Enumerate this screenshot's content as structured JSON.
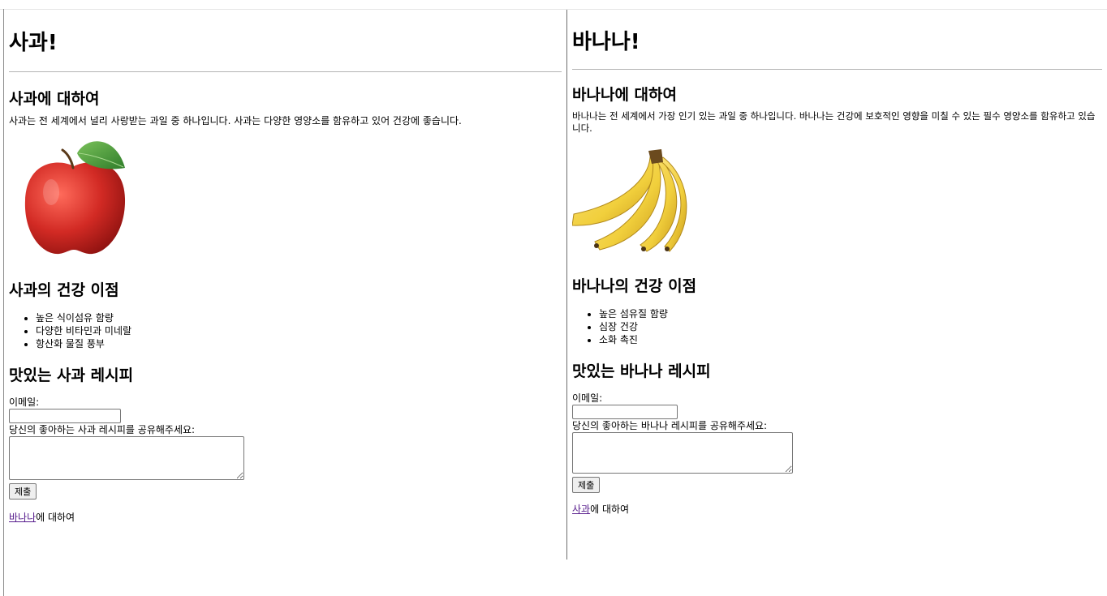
{
  "apple": {
    "title": "사과!",
    "about_heading": "사과에 대하여",
    "description": "사과는 전 세계에서 널리 사랑받는 과일 중 하나입니다. 사과는 다양한 영양소를 함유하고 있어 건강에 좋습니다.",
    "benefits_heading": "사과의 건강 이점",
    "benefits": [
      "높은 식이섬유 함량",
      "다양한 비타민과 미네랄",
      "항산화 물질 풍부"
    ],
    "recipe_heading": "맛있는 사과 레시피",
    "email_label": "이메일:",
    "email_value": "",
    "recipe_label": "당신의 좋아하는 사과 레시피를 공유해주세요:",
    "recipe_value": "",
    "submit_label": "제출",
    "link_text": "바나나",
    "link_suffix": "에 대하여"
  },
  "banana": {
    "title": "바나나!",
    "about_heading": "바나나에 대하여",
    "description": "바나나는 전 세계에서 가장 인기 있는 과일 중 하나입니다. 바나나는 건강에 보호적인 영향을 미칠 수 있는 필수 영양소를 함유하고 있습니다.",
    "benefits_heading": "바나나의 건강 이점",
    "benefits": [
      "높은 섬유질 함량",
      "심장 건강",
      "소화 촉진"
    ],
    "recipe_heading": "맛있는 바나나 레시피",
    "email_label": "이메일:",
    "email_value": "",
    "recipe_label": "당신의 좋아하는 바나나 레시피를 공유해주세요:",
    "recipe_value": "",
    "submit_label": "제출",
    "link_text": "사과",
    "link_suffix": "에 대하여"
  },
  "colors": {
    "visited_link": "#551a8b",
    "apple_red": "#d22a24",
    "banana_yellow": "#f1cf3c"
  }
}
